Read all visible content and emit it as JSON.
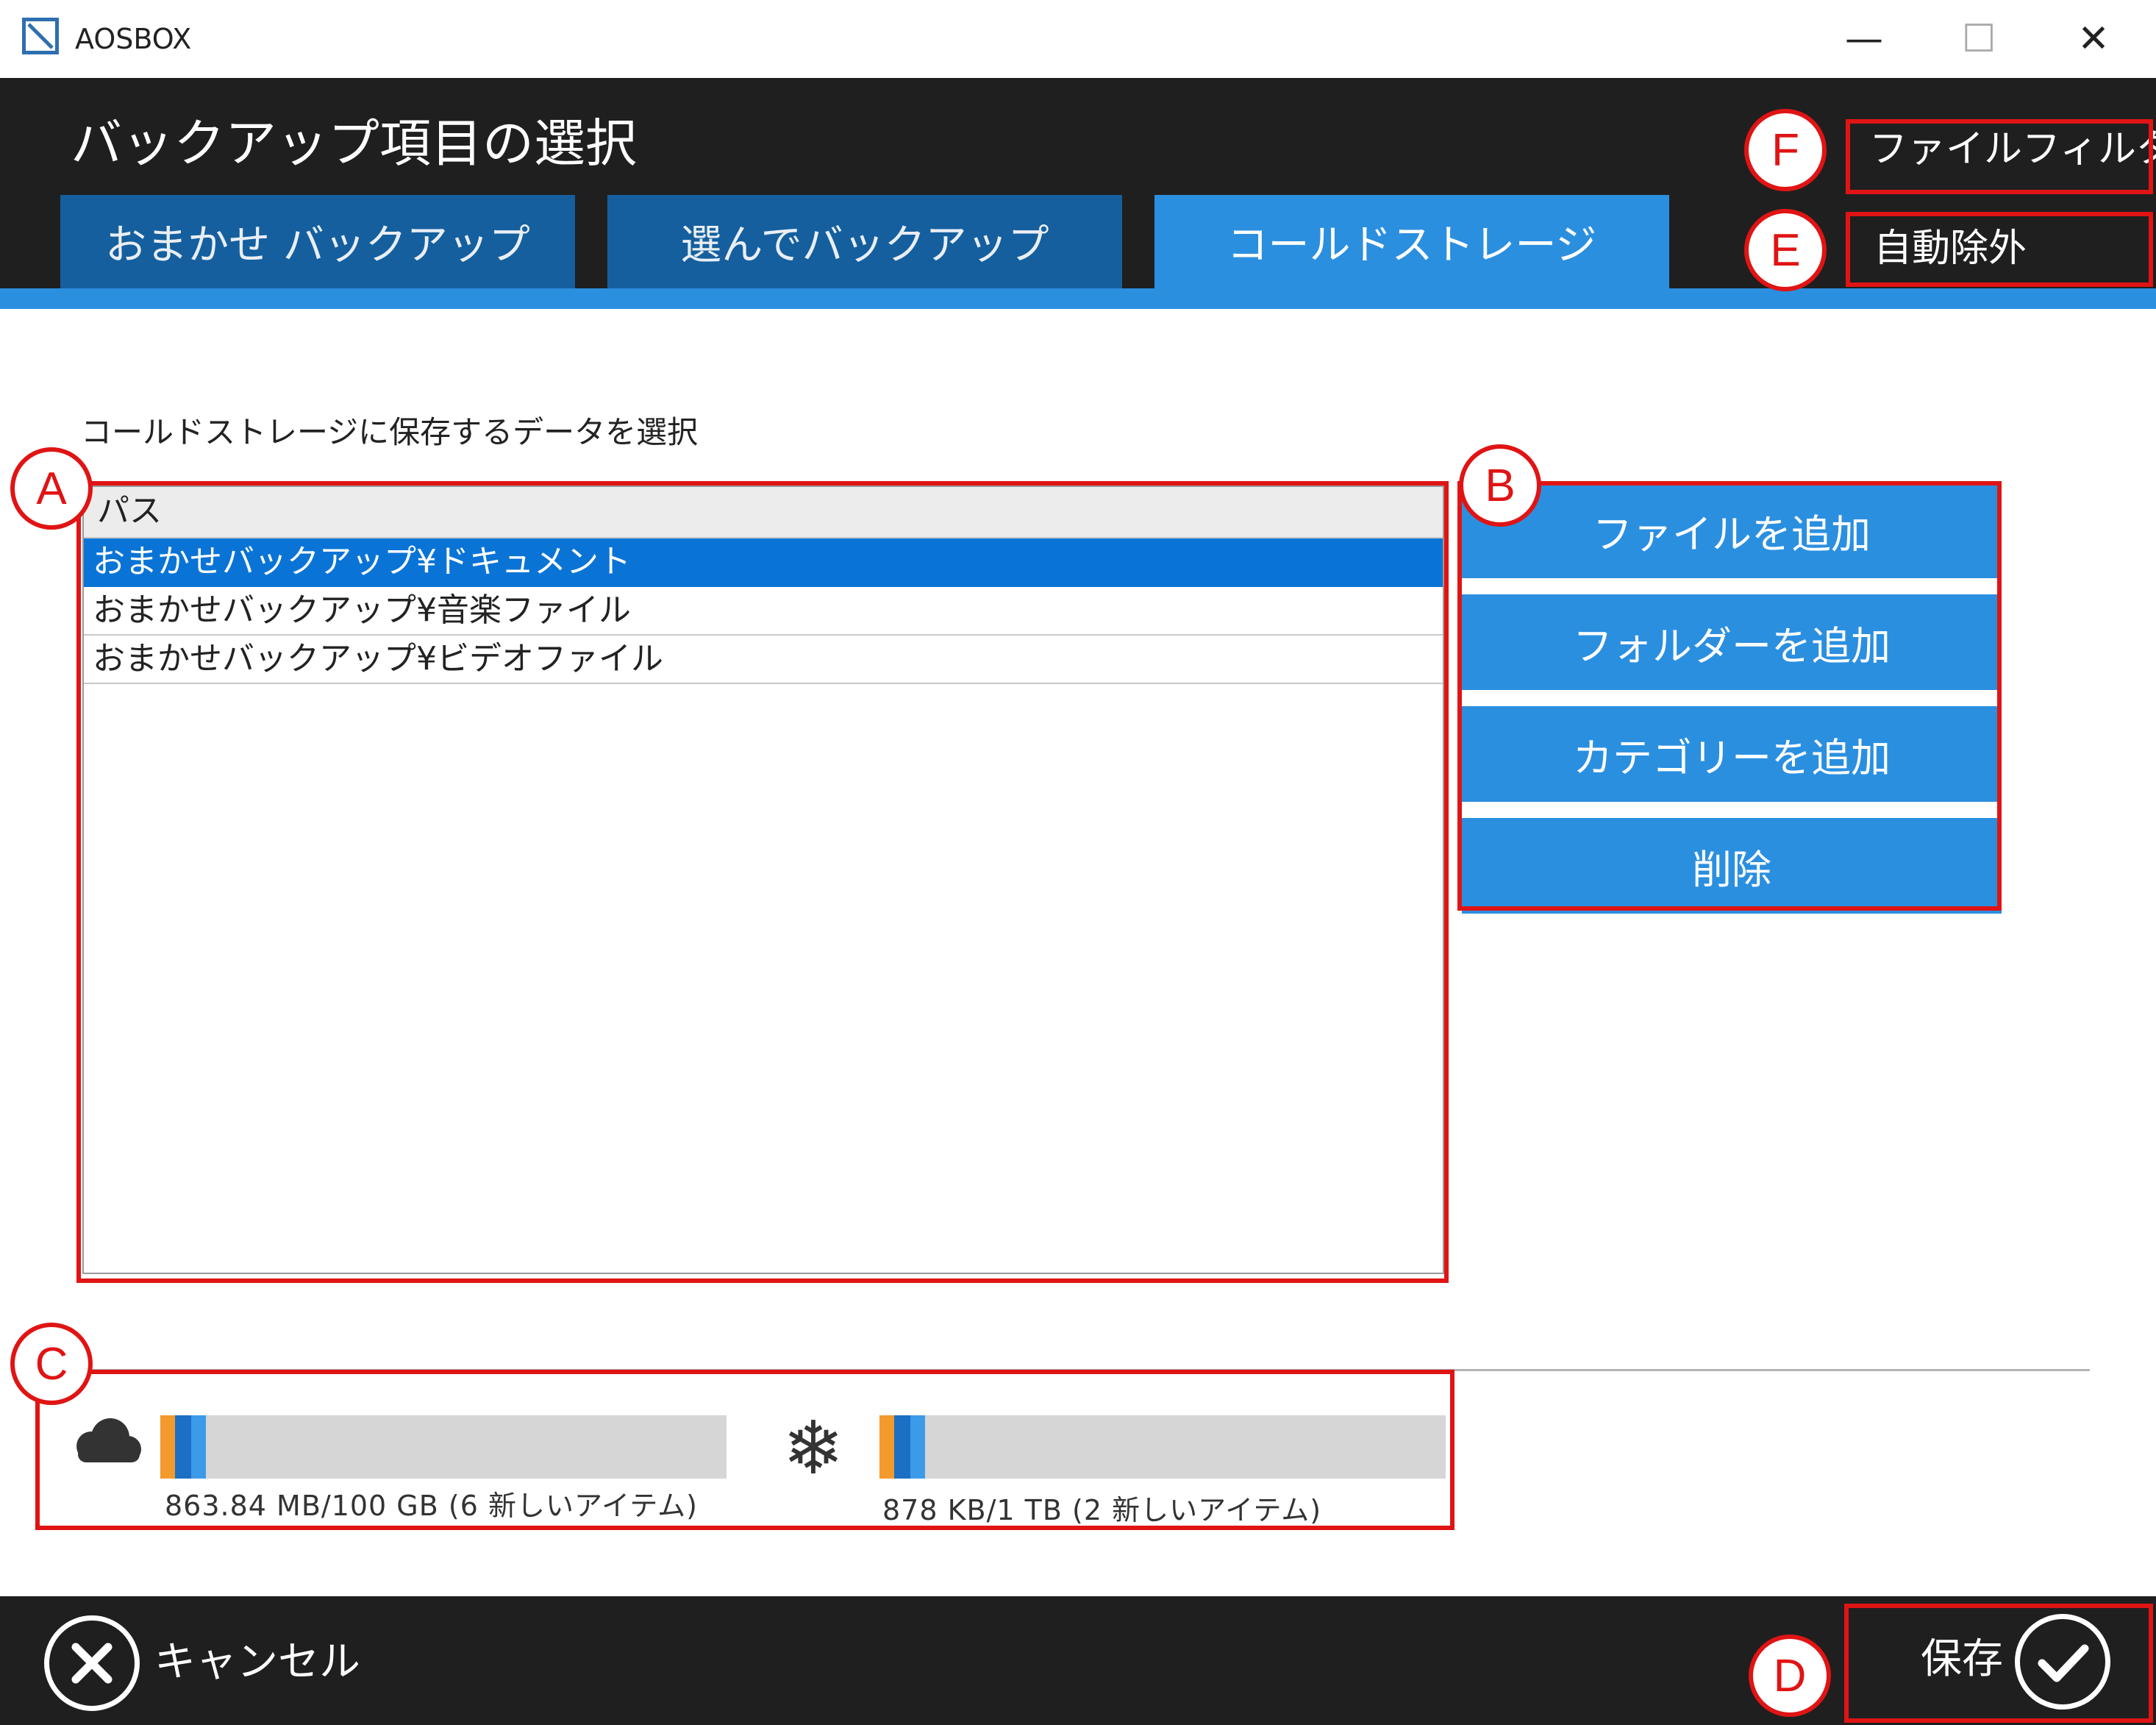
{
  "window": {
    "app_title": "AOSBOX",
    "minimize_glyph": "—",
    "maximize_glyph": "☐",
    "close_glyph": "✕"
  },
  "header": {
    "page_title": "バックアップ項目の選択",
    "tabs": [
      {
        "label": "おまかせ バックアップ"
      },
      {
        "label": "選んでバックアップ"
      },
      {
        "label": "コールドストレージ",
        "active": true
      }
    ],
    "file_filter_label": "ファイルフィルター",
    "auto_exclude_label": "自動除外"
  },
  "content": {
    "section_label": "コールドストレージに保存するデータを選択",
    "list": {
      "column_header": "パス",
      "rows": [
        {
          "path": "おまかせバックアップ¥ドキュメント",
          "selected": true
        },
        {
          "path": "おまかせバックアップ¥音楽ファイル",
          "selected": false
        },
        {
          "path": "おまかせバックアップ¥ビデオファイル",
          "selected": false
        }
      ]
    },
    "actions": {
      "add_file": "ファイルを追加",
      "add_folder": "フォルダーを追加",
      "add_category": "カテゴリーを追加",
      "delete": "削除"
    }
  },
  "storage": {
    "cloud": {
      "icon": "cloud-icon",
      "text": "863.84 MB/100 GB (6 新しいアイテム)"
    },
    "cold": {
      "icon": "snowflake-icon",
      "text": "878 KB/1 TB (2 新しいアイテム)"
    },
    "segment_colors": [
      "#f39a2c",
      "#1b6fc4",
      "#3c9be8"
    ]
  },
  "footer": {
    "cancel_label": "キャンセル",
    "save_label": "保存"
  },
  "annotations": {
    "A": "A",
    "B": "B",
    "C": "C",
    "D": "D",
    "E": "E",
    "F": "F",
    "color": "#e01414"
  },
  "colors": {
    "accent": "#2b8fe0",
    "tab_inactive": "#155f9e",
    "header_bg": "#1f1f1f",
    "selected_row": "#0a74d6"
  }
}
